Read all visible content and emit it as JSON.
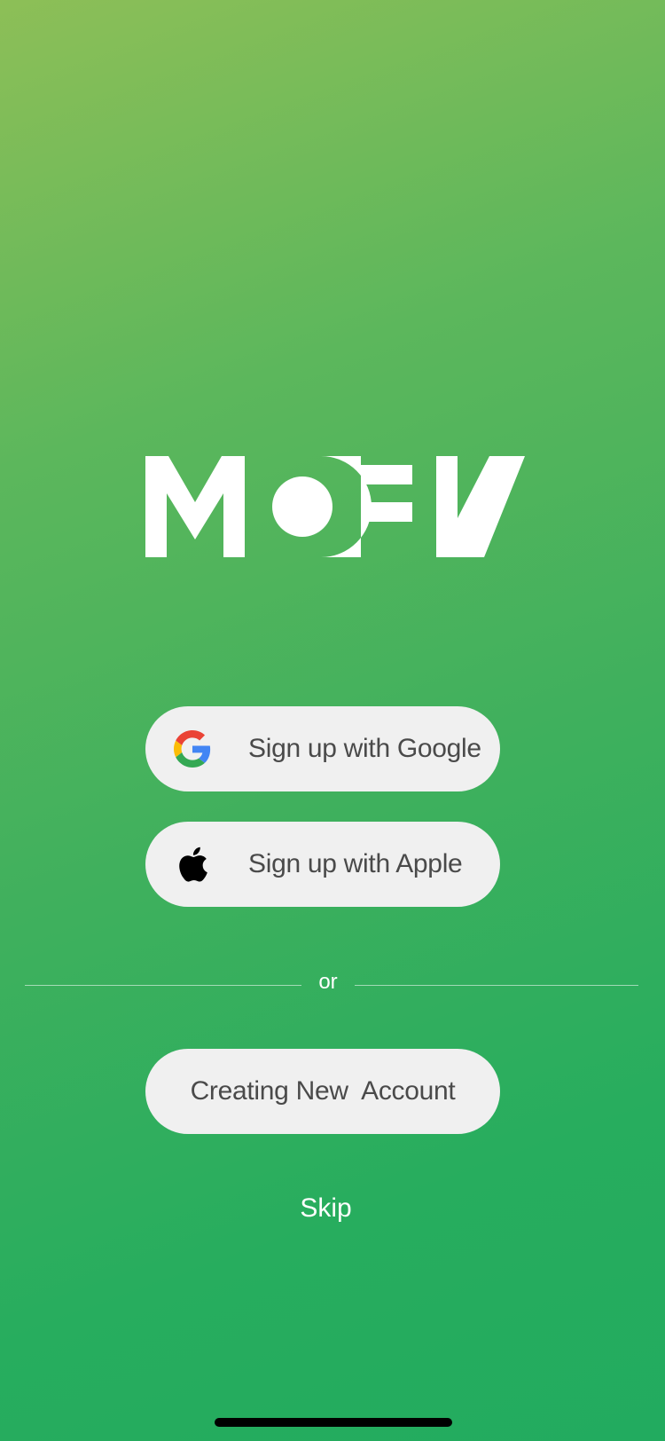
{
  "app": {
    "logo_text": "MOEV"
  },
  "auth": {
    "google_label": "Sign up with Google",
    "apple_label": "Sign up with Apple",
    "divider_text": "or",
    "create_account_label": "Creating New  Account",
    "skip_label": "Skip"
  },
  "icons": {
    "google": "google-g-icon",
    "apple": "apple-logo-icon"
  },
  "colors": {
    "gradient_start": "#8dbf57",
    "gradient_end": "#22ab5f",
    "button_bg": "#f0f0f0",
    "button_text": "#4a4a4a",
    "text_light": "#ffffff"
  }
}
